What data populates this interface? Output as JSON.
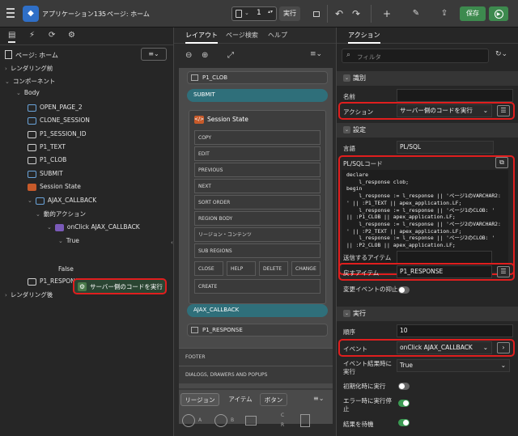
{
  "topbar": {
    "app_name": "アプリケーション135",
    "separator": "\\",
    "page_name": "ページ: ホーム",
    "page_number": "1",
    "run_label": "実行",
    "save_label": "保存",
    "add_label": "+",
    "chev": "⌄",
    "undo": "↶",
    "redo": "↷"
  },
  "left": {
    "page_label": "ページ: ホーム",
    "tree": [
      {
        "text": "レンダリング前",
        "indent": 0,
        "chevron": "›",
        "icon": ""
      },
      {
        "text": "コンポーネント",
        "indent": 0,
        "chevron": "⌄",
        "icon": ""
      },
      {
        "text": "Body",
        "indent": 1,
        "chevron": "⌄",
        "icon": ""
      },
      {
        "text": "OPEN_PAGE_2",
        "indent": 2,
        "chevron": "",
        "icon": "button"
      },
      {
        "text": "CLONE_SESSION",
        "indent": 2,
        "chevron": "",
        "icon": "button"
      },
      {
        "text": "P1_SESSION_ID",
        "indent": 2,
        "chevron": "",
        "icon": "hidden"
      },
      {
        "text": "P1_TEXT",
        "indent": 2,
        "chevron": "",
        "icon": "text"
      },
      {
        "text": "P1_CLOB",
        "indent": 2,
        "chevron": "",
        "icon": "text"
      },
      {
        "text": "SUBMIT",
        "indent": 2,
        "chevron": "",
        "icon": "button"
      },
      {
        "text": "Session State",
        "indent": 2,
        "chevron": "",
        "icon": "plsql"
      },
      {
        "text": "AJAX_CALLBACK",
        "indent": 2,
        "chevron": "⌄",
        "icon": "button"
      },
      {
        "text": "動的アクション",
        "indent": 3,
        "chevron": "⌄",
        "icon": ""
      },
      {
        "text": "onClick AJAX_CALLBACK",
        "indent": 4,
        "chevron": "⌄",
        "icon": "da"
      },
      {
        "text": "True",
        "indent": 5,
        "chevron": "⌄",
        "icon": ""
      },
      {
        "text": "",
        "indent": 6,
        "chevron": "",
        "icon": ""
      },
      {
        "text": "False",
        "indent": 5,
        "chevron": "",
        "icon": ""
      },
      {
        "text": "P1_RESPONSE",
        "indent": 2,
        "chevron": "",
        "icon": "text"
      },
      {
        "text": "レンダリング後",
        "indent": 0,
        "chevron": "›",
        "icon": ""
      }
    ],
    "selected_action": "サーバー側のコードを実行"
  },
  "middle": {
    "tabs": [
      "レイアウト",
      "ページ検索",
      "ヘルプ"
    ],
    "regions": {
      "p1_clob": "P1_CLOB",
      "submit": "SUBMIT",
      "session_state": "Session State",
      "ajax": "AJAX_CALLBACK",
      "p1_response": "P1_RESPONSE"
    },
    "slots": [
      "COPY",
      "EDIT",
      "PREVIOUS",
      "NEXT",
      "SORT ORDER",
      "REGION BODY",
      "リージョン・コンテンツ",
      "SUB REGIONS"
    ],
    "row_slots": [
      "CLOSE",
      "HELP",
      "DELETE",
      "CHANGE"
    ],
    "create_slot": "CREATE",
    "footer": "FOOTER",
    "dialogs": "DIALOGS, DRAWERS AND POPUPS",
    "bottom_tabs": [
      "リージョン",
      "アイテム",
      "ボタン"
    ],
    "gallery": [
      "A",
      "B",
      "C",
      "R"
    ]
  },
  "right": {
    "tab": "アクション",
    "filter_placeholder": "フィルタ",
    "sections": {
      "identification": "識別",
      "settings": "設定",
      "execution": "実行"
    },
    "fields": {
      "name_label": "名前",
      "name_value": "",
      "action_label": "アクション",
      "action_value": "サーバー側のコードを実行",
      "language_label": "言語",
      "language_value": "PL/SQL",
      "plsql_label": "PL/SQLコード",
      "submit_items_label": "送信するアイテム",
      "return_items_label": "戻すアイテム",
      "return_items_value": "P1_RESPONSE",
      "suppress_label": "変更イベントの抑止",
      "seq_label": "順序",
      "seq_value": "10",
      "event_label": "イベント",
      "event_value": "onClick AJAX_CALLBACK",
      "fire_when_label_1": "イベント結果時に",
      "fire_when_label_2": "実行",
      "fire_when_value": "True",
      "fire_init_label": "初期化時に実行",
      "stop_err_label_1": "エラー時に実行停",
      "stop_err_label_2": "止",
      "wait_label": "結果を待機"
    },
    "code_lines": [
      "declare",
      "    l_response clob;",
      "begin",
      "    l_response := l_response || 'ページ1のVARCHAR2:",
      "' || :P1_TEXT || apex_application.LF;",
      "    l_response := l_response || 'ページ1のCLOB: '",
      "|| :P1_CLOB || apex_application.LF;",
      "    l_response := l_response || 'ページ2のVARCHAR2:",
      "' || :P2_TEXT || apex_application.LF;",
      "    l_response := l_response || 'ページ2のCLOB: '",
      "|| :P2_CLOB || apex_application.LF;"
    ],
    "toggles": {
      "suppress": false,
      "fire_init": false,
      "stop_err": true,
      "wait": true
    }
  },
  "colors": {
    "accent_red": "#e01e1e",
    "toggle_on": "#3a9a52",
    "save_green": "#3d8a4e",
    "teal": "#2f6f7a"
  }
}
